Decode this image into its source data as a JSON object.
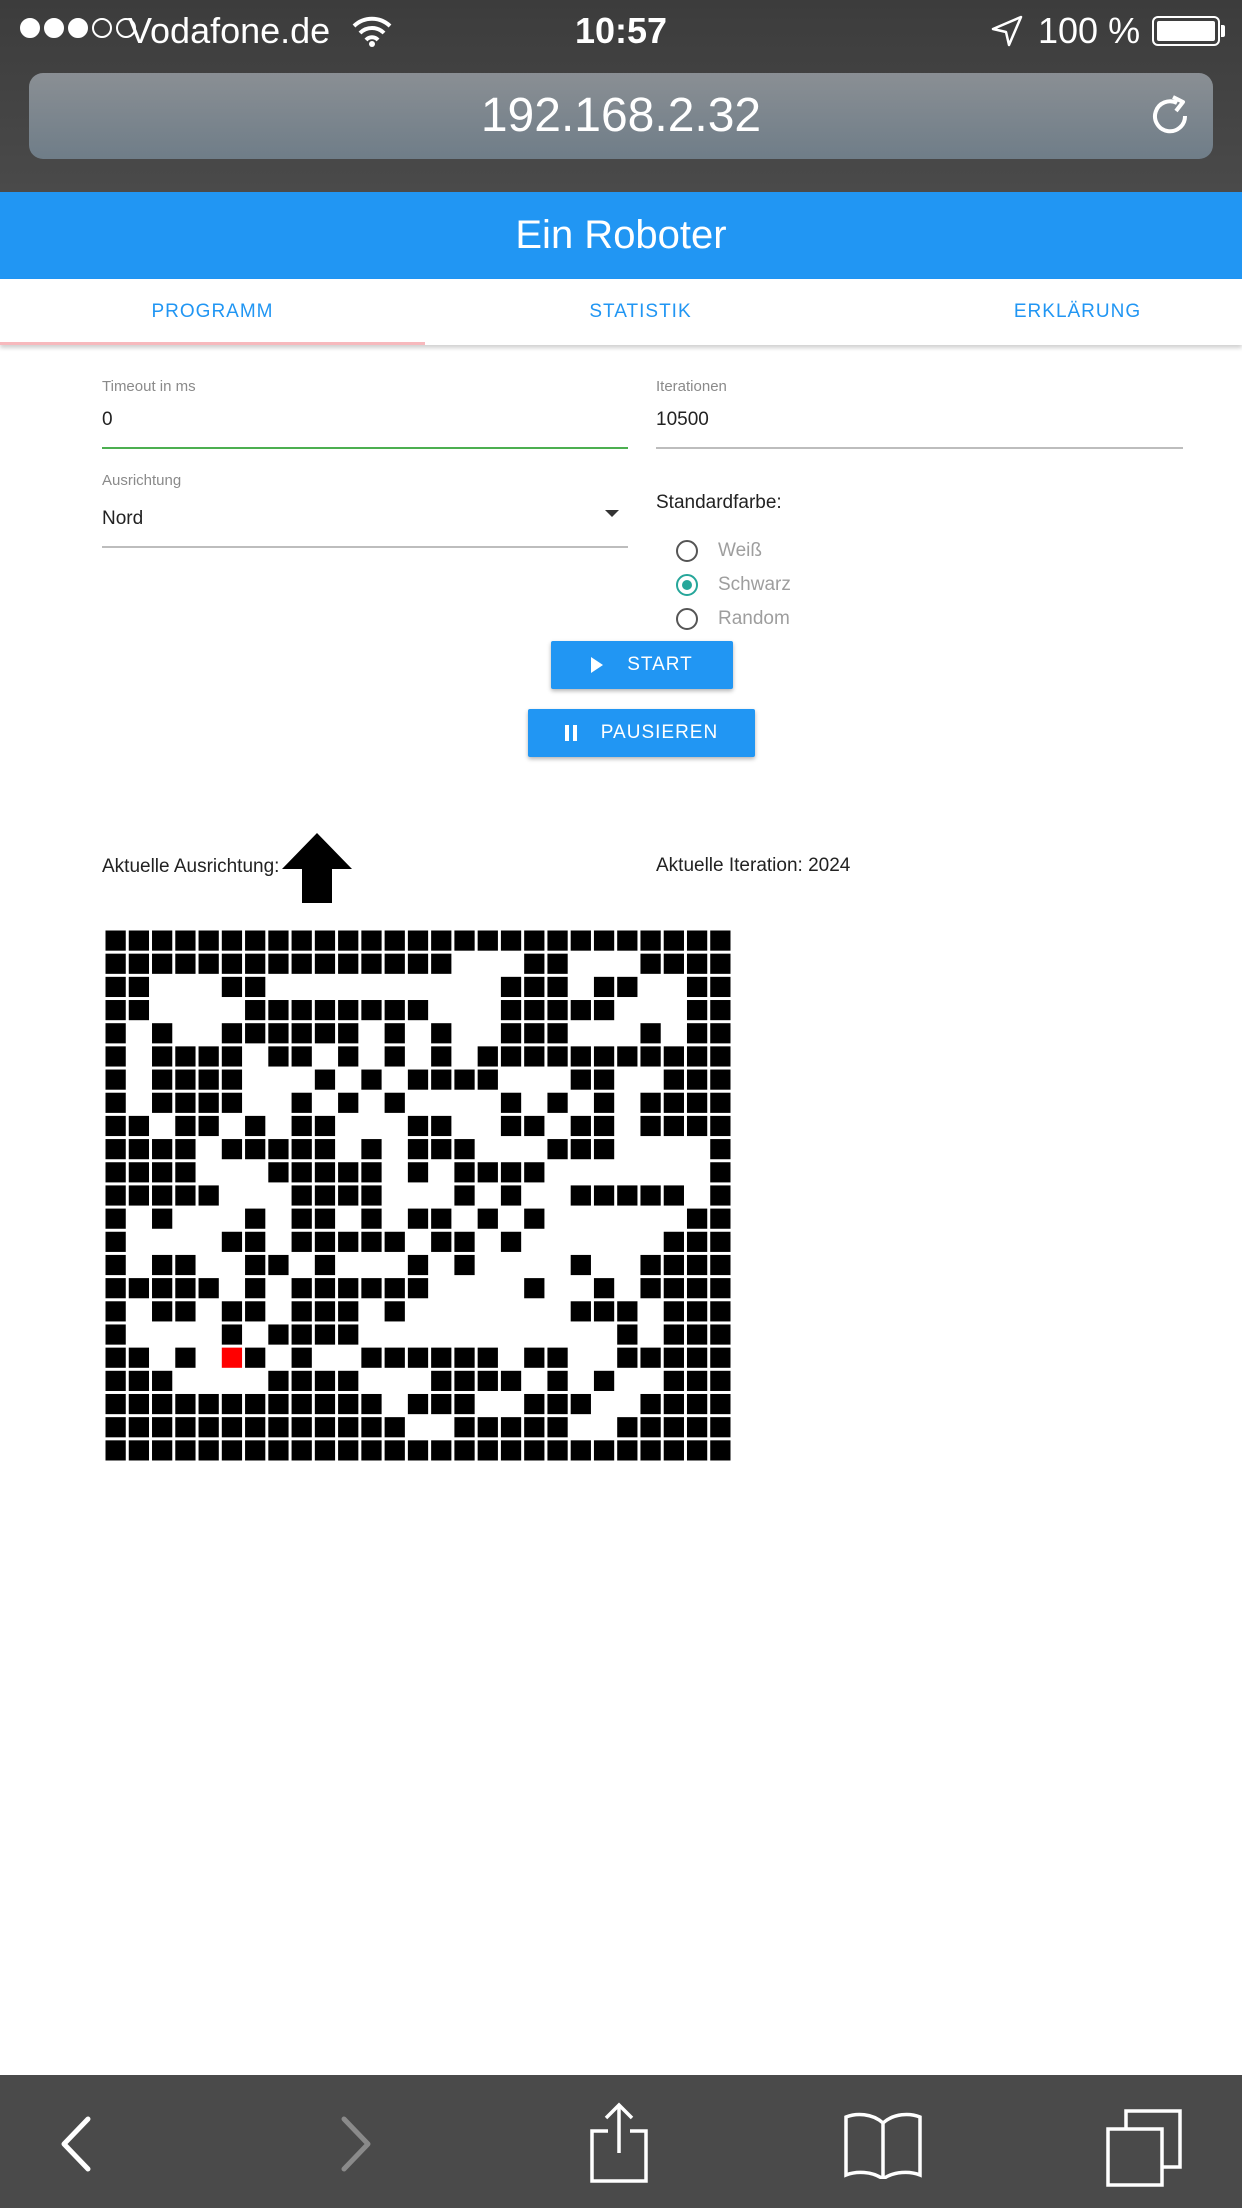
{
  "status_bar": {
    "carrier": "Vodafone.de",
    "time": "10:57",
    "battery": "100 %"
  },
  "browser": {
    "url": "192.168.2.32"
  },
  "app": {
    "title": "Ein Roboter",
    "tabs": [
      {
        "label": "PROGRAMM",
        "active": true
      },
      {
        "label": "STATISTIK",
        "active": false
      },
      {
        "label": "ERKLÄRUNG",
        "active": false
      }
    ],
    "fields": {
      "timeout": {
        "label": "Timeout in ms",
        "value": "0"
      },
      "iterations": {
        "label": "Iterationen",
        "value": "10500"
      },
      "orientation": {
        "label": "Ausrichtung",
        "value": "Nord"
      }
    },
    "default_color": {
      "label": "Standardfarbe:",
      "options": [
        {
          "label": "Weiß",
          "checked": false
        },
        {
          "label": "Schwarz",
          "checked": true
        },
        {
          "label": "Random",
          "checked": false
        }
      ]
    },
    "buttons": {
      "start": "START",
      "pause": "PAUSIEREN"
    },
    "current_orientation_label": "Aktuelle Ausrichtung:",
    "current_iteration_label": "Aktuelle Iteration: 2024",
    "grid": {
      "columns": 27,
      "rows": 23,
      "robot": {
        "row": 18,
        "col": 5
      },
      "robot_color": "#ff0000",
      "cells": [
        "111111111111111111111111111",
        "111111111111111000110001111",
        "110001100000000001110110011",
        "110000111111110001111100011",
        "101001111110101001110001011",
        "101111011010101011111111111",
        "101111000101011110001100111",
        "101111001010100001010101111",
        "110110101100011001101101111",
        "111101111101011100011100001",
        "111100011111010111100000001",
        "111110001111000101001111101",
        "101000101101011010100000011",
        "100001101111101101000000111",
        "101100110100010100001001111",
        "111110101111110000100101111",
        "101101101110100000001110111",
        "100001011110000000000010111",
        "110101101001111110110011111",
        "111000011110001111010100111",
        "111111111111011100111001111",
        "111111111111100111110011111",
        "111111111111111111111111111"
      ]
    }
  },
  "colors": {
    "primary": "#2196F3",
    "radio_checked": "#26a69a",
    "field_active_underline": "#4caf50",
    "tab_indicator": "#f7b9bd"
  },
  "icons": [
    "wifi-icon",
    "location-arrow-icon",
    "reload-icon",
    "dropdown-caret-icon",
    "play-icon",
    "pause-icon",
    "orientation-arrow-up-icon",
    "back-icon",
    "forward-icon",
    "share-icon",
    "bookmarks-icon",
    "tabs-icon"
  ]
}
